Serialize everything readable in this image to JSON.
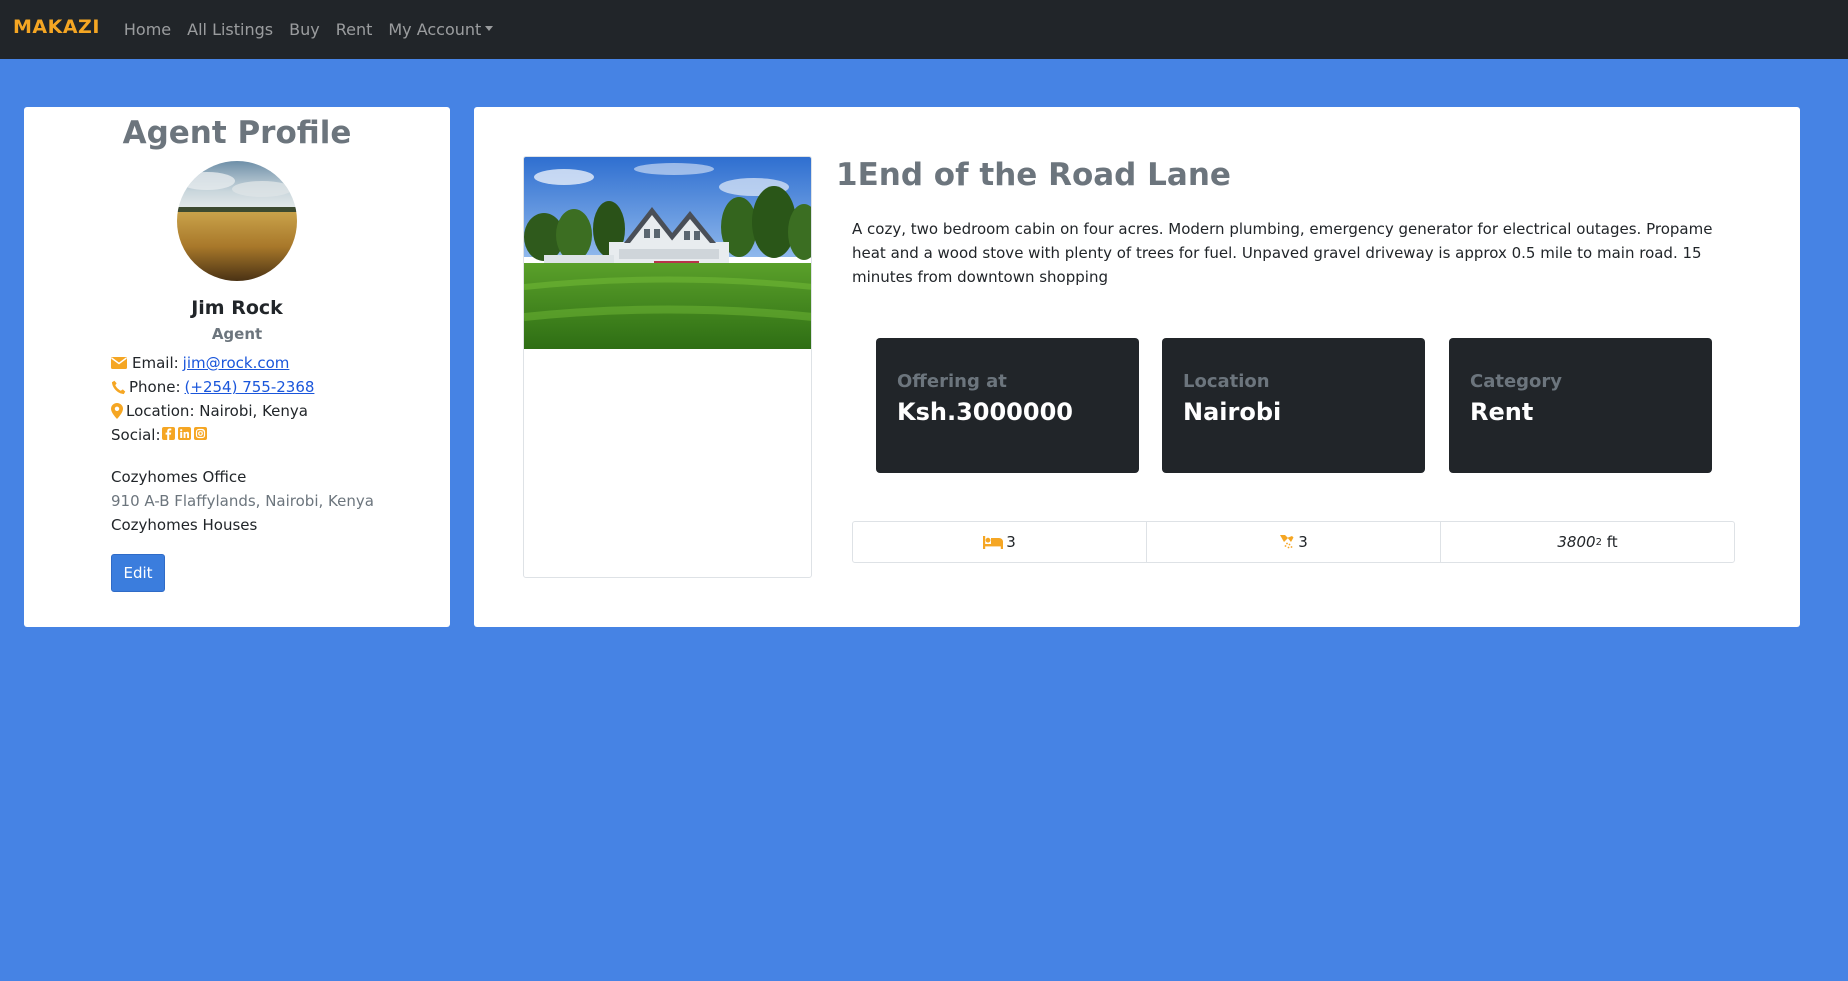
{
  "nav": {
    "brand": "MAKAZI",
    "links": [
      "Home",
      "All Listings",
      "Buy",
      "Rent",
      "My Account"
    ]
  },
  "agent": {
    "heading": "Agent Profile",
    "name": "Jim Rock",
    "role": "Agent",
    "email_label": "Email:",
    "email": "jim@rock.com",
    "phone_label": "Phone:",
    "phone": "(+254) 755-2368",
    "location_label": "Location: Nairobi, Kenya",
    "social_label": "Social:",
    "office_name": "Cozyhomes Office",
    "office_address": "910 A-B Flaffylands, Nairobi, Kenya",
    "company": "Cozyhomes Houses",
    "edit_label": "Edit"
  },
  "listing": {
    "title": "1End of the Road Lane",
    "description": "A cozy, two bedroom cabin on four acres. Modern plumbing, emergency generator for electrical outages. Propame heat and a wood stove with plenty of trees for fuel. Unpaved gravel driveway is approx 0.5 mile to main road. 15 minutes from downtown shopping",
    "stats": [
      {
        "label": "Offering at",
        "value": "Ksh.3000000"
      },
      {
        "label": "Location",
        "value": "Nairobi"
      },
      {
        "label": "Category",
        "value": "Rent"
      }
    ],
    "bedrooms": "3",
    "bathrooms": "3",
    "area": "3800",
    "area_exp": "2",
    "area_unit": "ft"
  },
  "colors": {
    "page_bg": "#4683e4",
    "navbar_bg": "#212529",
    "brand": "#f5a623",
    "icon_accent": "#f5a623",
    "stat_bg": "#212529",
    "button": "#3b7ddd"
  },
  "icons": [
    "envelope-icon",
    "phone-icon",
    "map-marker-icon",
    "facebook-icon",
    "linkedin-icon",
    "instagram-icon",
    "bed-icon",
    "shower-icon"
  ]
}
